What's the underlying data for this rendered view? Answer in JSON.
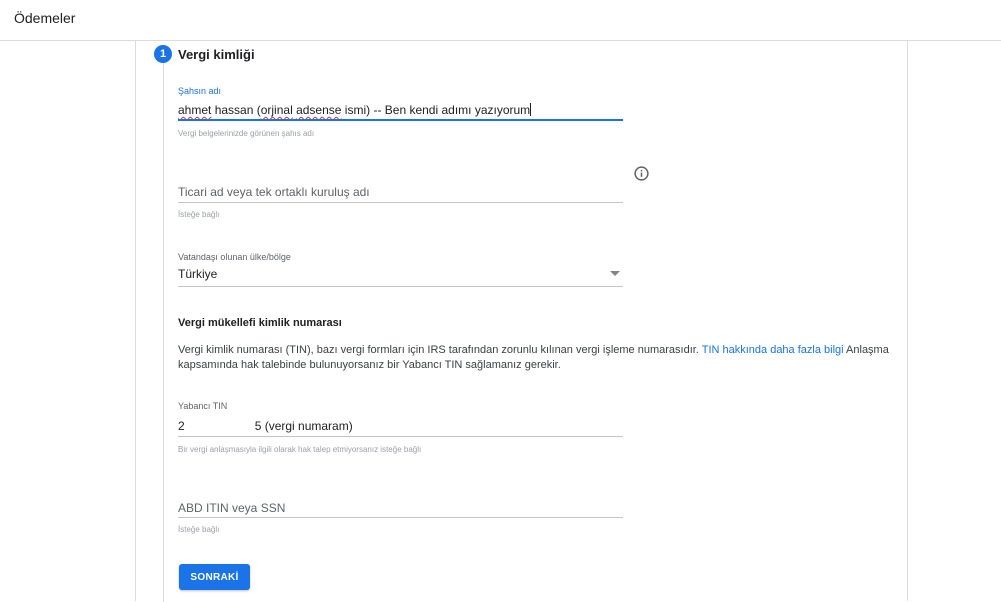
{
  "header": {
    "title": "Ödemeler"
  },
  "step": {
    "number": "1",
    "title": "Vergi kimliği"
  },
  "person_name": {
    "label": "Şahsın adı",
    "value_words": {
      "w1": "ahmet",
      "w2": " hassan (",
      "w3": "orjinal",
      "w4": " ",
      "w5": "adsense",
      "w6": " ismi) -- Ben kendi adımı yazıyorum"
    },
    "helper": "Vergi belgelerinizde görünen şahıs adı"
  },
  "trade_name": {
    "placeholder": "Ticari ad veya tek ortaklı kuruluş adı",
    "helper": "İsteğe bağlı"
  },
  "citizenship": {
    "label": "Vatandaşı olunan ülke/bölge",
    "value": "Türkiye"
  },
  "tin_section": {
    "heading": "Vergi mükellefi kimlik numarası",
    "desc_part1": "Vergi kimlik numarası (TIN), bazı vergi formları için IRS tarafından zorunlu kılınan vergi işleme numarasıdır. ",
    "desc_link": "TIN hakkında daha fazla bilgi",
    "desc_part2": " Anlaşma kapsamında hak talebinde bulunuyorsanız bir Yabancı TIN sağlamanız gerekir."
  },
  "foreign_tin": {
    "label": "Yabancı TIN",
    "value_prefix": "2",
    "value_suffix": "5 (vergi numaram)",
    "helper": "Bir vergi anlaşmasıyla ilgili olarak hak talep etmiyorsanız isteğe bağlı"
  },
  "us_tin": {
    "placeholder": "ABD ITIN veya SSN",
    "helper": "İsteğe bağlı"
  },
  "actions": {
    "next_label": "SONRAKİ"
  },
  "colors": {
    "accent": "#1a73e8",
    "spell_error": "#d93025",
    "divider": "#dadce0"
  }
}
